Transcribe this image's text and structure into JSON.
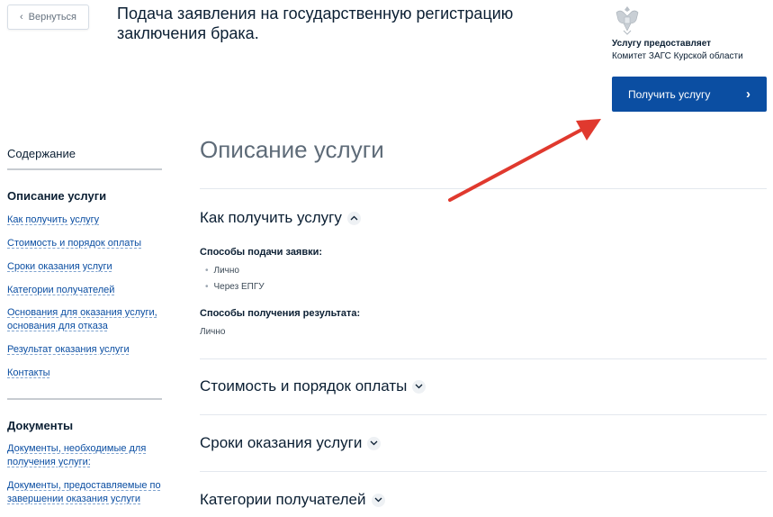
{
  "header": {
    "back_label": "Вернуться",
    "title": "Подача заявления на государственную регистрацию заключения брака."
  },
  "provider": {
    "label": "Услугу предоставляет",
    "name": "Комитет ЗАГС Курской области",
    "button_label": "Получить услугу"
  },
  "sidebar": {
    "toc_title": "Содержание",
    "description": {
      "heading": "Описание услуги",
      "links": [
        "Как получить услугу",
        "Стоимость и порядок оплаты",
        "Сроки оказания услуги",
        "Категории получателей",
        "Основания для оказания услуги, основания для отказа",
        "Результат оказания услуги",
        "Контакты"
      ]
    },
    "documents": {
      "heading": "Документы",
      "links": [
        "Документы, необходимые для получения услуги:",
        "Документы, предоставляемые по завершении оказания услуги"
      ]
    }
  },
  "main": {
    "heading": "Описание услуги",
    "sections": [
      {
        "title": "Как получить услугу",
        "submission_label": "Способы подачи заявки:",
        "submission_items": [
          "Лично",
          "Через ЕПГУ"
        ],
        "result_label": "Способы получения результата:",
        "result_value": "Лично"
      },
      {
        "title": "Стоимость и порядок оплаты"
      },
      {
        "title": "Сроки оказания услуги"
      },
      {
        "title": "Категории получателей"
      }
    ]
  },
  "colors": {
    "primary_button": "#0b4ea2",
    "link": "#0b4ea2",
    "annotation_arrow": "#e0392e"
  }
}
